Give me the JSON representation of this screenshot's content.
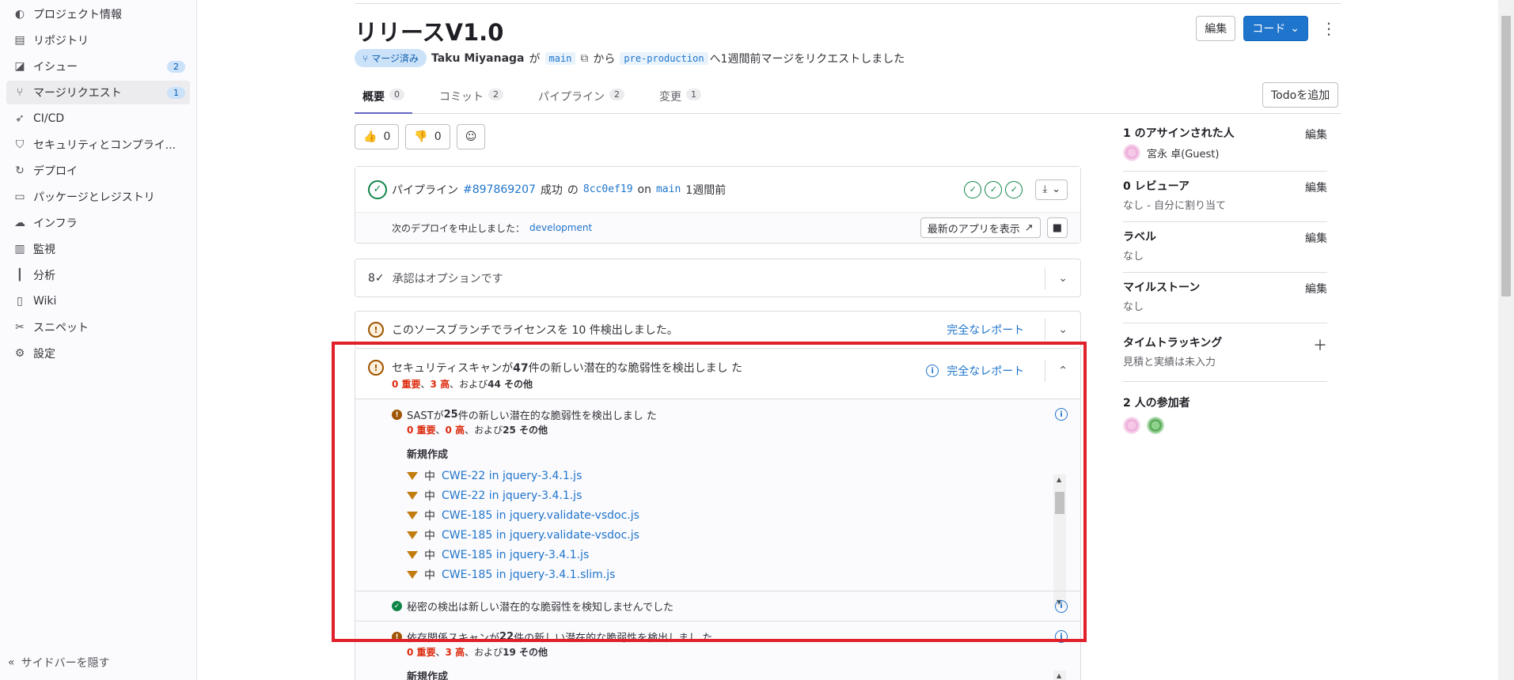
{
  "sidebar": {
    "items": [
      {
        "icon": "project-icon",
        "label": "プロジェクト情報"
      },
      {
        "icon": "doc-icon",
        "label": "リポジトリ"
      },
      {
        "icon": "issues-icon",
        "label": "イシュー",
        "count": "2"
      },
      {
        "icon": "merge-icon",
        "label": "マージリクエスト",
        "count": "1",
        "active": true
      },
      {
        "icon": "rocket-icon",
        "label": "CI/CD"
      },
      {
        "icon": "shield-icon",
        "label": "セキュリティとコンプライ..."
      },
      {
        "icon": "deploy-icon",
        "label": "デプロイ"
      },
      {
        "icon": "package-icon",
        "label": "パッケージとレジストリ"
      },
      {
        "icon": "cloud-icon",
        "label": "インフラ"
      },
      {
        "icon": "monitor-icon",
        "label": "監視"
      },
      {
        "icon": "chart-icon",
        "label": "分析"
      },
      {
        "icon": "book-icon",
        "label": "Wiki"
      },
      {
        "icon": "scissors-icon",
        "label": "スニペット"
      },
      {
        "icon": "gear-icon",
        "label": "設定"
      }
    ],
    "hide_label": "サイドバーを隠す"
  },
  "header": {
    "title": "リリースV1.0",
    "edit_label": "編集",
    "code_label": "コード",
    "status_badge": "マージ済み",
    "author": "Taku Miyanaga",
    "ga": "が",
    "source_branch": "main",
    "kara": "から",
    "target_branch": "pre-production",
    "meta_suffix": "へ1週間前マージをリクエストしました"
  },
  "tabs": [
    {
      "label": "概要",
      "count": "0"
    },
    {
      "label": "コミット",
      "count": "2"
    },
    {
      "label": "パイプライン",
      "count": "2"
    },
    {
      "label": "変更",
      "count": "1"
    }
  ],
  "todo_label": "Todoを追加",
  "reactions": {
    "thumbs_up": "0",
    "thumbs_down": "0"
  },
  "pipeline": {
    "prefix": "パイプライン",
    "id": "#897869207",
    "status": "成功",
    "of": "の",
    "commit": "8cc0ef19",
    "on": "on",
    "branch": "main",
    "time": "1週間前",
    "deploy_text": "次のデプロイを中止しました：",
    "env": "development",
    "view_app_label": "最新のアプリを表示"
  },
  "approval_text": "承認はオプションです",
  "license": {
    "text": "このソースブランチでライセンスを 10 件検出しました。",
    "report_link": "完全なレポート"
  },
  "security": {
    "title_pre": "セキュリティスキャンが",
    "title_num": "47",
    "title_post": "件の新しい潜在的な脆弱性を検出しまし た",
    "critical": "0 重要",
    "sep1": "、",
    "high": "3 高",
    "sep2": "、および",
    "other": "44 その他",
    "report_link": "完全なレポート",
    "sast": {
      "pre": "SASTが",
      "num": "25",
      "post": "件の新しい潜在的な脆弱性を検出しまし た",
      "critical": "0 重要",
      "high": "0 高",
      "other": "25 その他",
      "new_label": "新規作成",
      "vulns": [
        {
          "severity": "中",
          "name": "CWE-22 in jquery-3.4.1.js"
        },
        {
          "severity": "中",
          "name": "CWE-22 in jquery-3.4.1.js"
        },
        {
          "severity": "中",
          "name": "CWE-185 in jquery.validate-vsdoc.js"
        },
        {
          "severity": "中",
          "name": "CWE-185 in jquery.validate-vsdoc.js"
        },
        {
          "severity": "中",
          "name": "CWE-185 in jquery-3.4.1.js"
        },
        {
          "severity": "中",
          "name": "CWE-185 in jquery-3.4.1.slim.js"
        }
      ]
    },
    "secret_text": "秘密の検出は新しい潜在的な脆弱性を検知しませんでした",
    "dep": {
      "pre": "依存関係スキャンが",
      "num": "22",
      "post": "件の新しい潜在的な脆弱性を検出しまし た",
      "critical": "0 重要",
      "high": "3 高",
      "other": "19 その他",
      "new_label": "新規作成"
    }
  },
  "right_sidebar": {
    "assignee_title": "1 のアサインされた人",
    "assignee_name": "宮永 卓(Guest)",
    "reviewer_title": "0 レビューア",
    "reviewer_val": "なし - 自分に割り当て",
    "label_title": "ラベル",
    "label_val": "なし",
    "milestone_title": "マイルストーン",
    "milestone_val": "なし",
    "time_title": "タイムトラッキング",
    "time_val": "見積と実績は未入力",
    "participants_title": "2 人の参加者",
    "edit_label": "編集"
  },
  "colors": {
    "accent": "#1f75cb",
    "highlight": "#e0212a",
    "warning": "#9e5400",
    "success": "#108548"
  }
}
